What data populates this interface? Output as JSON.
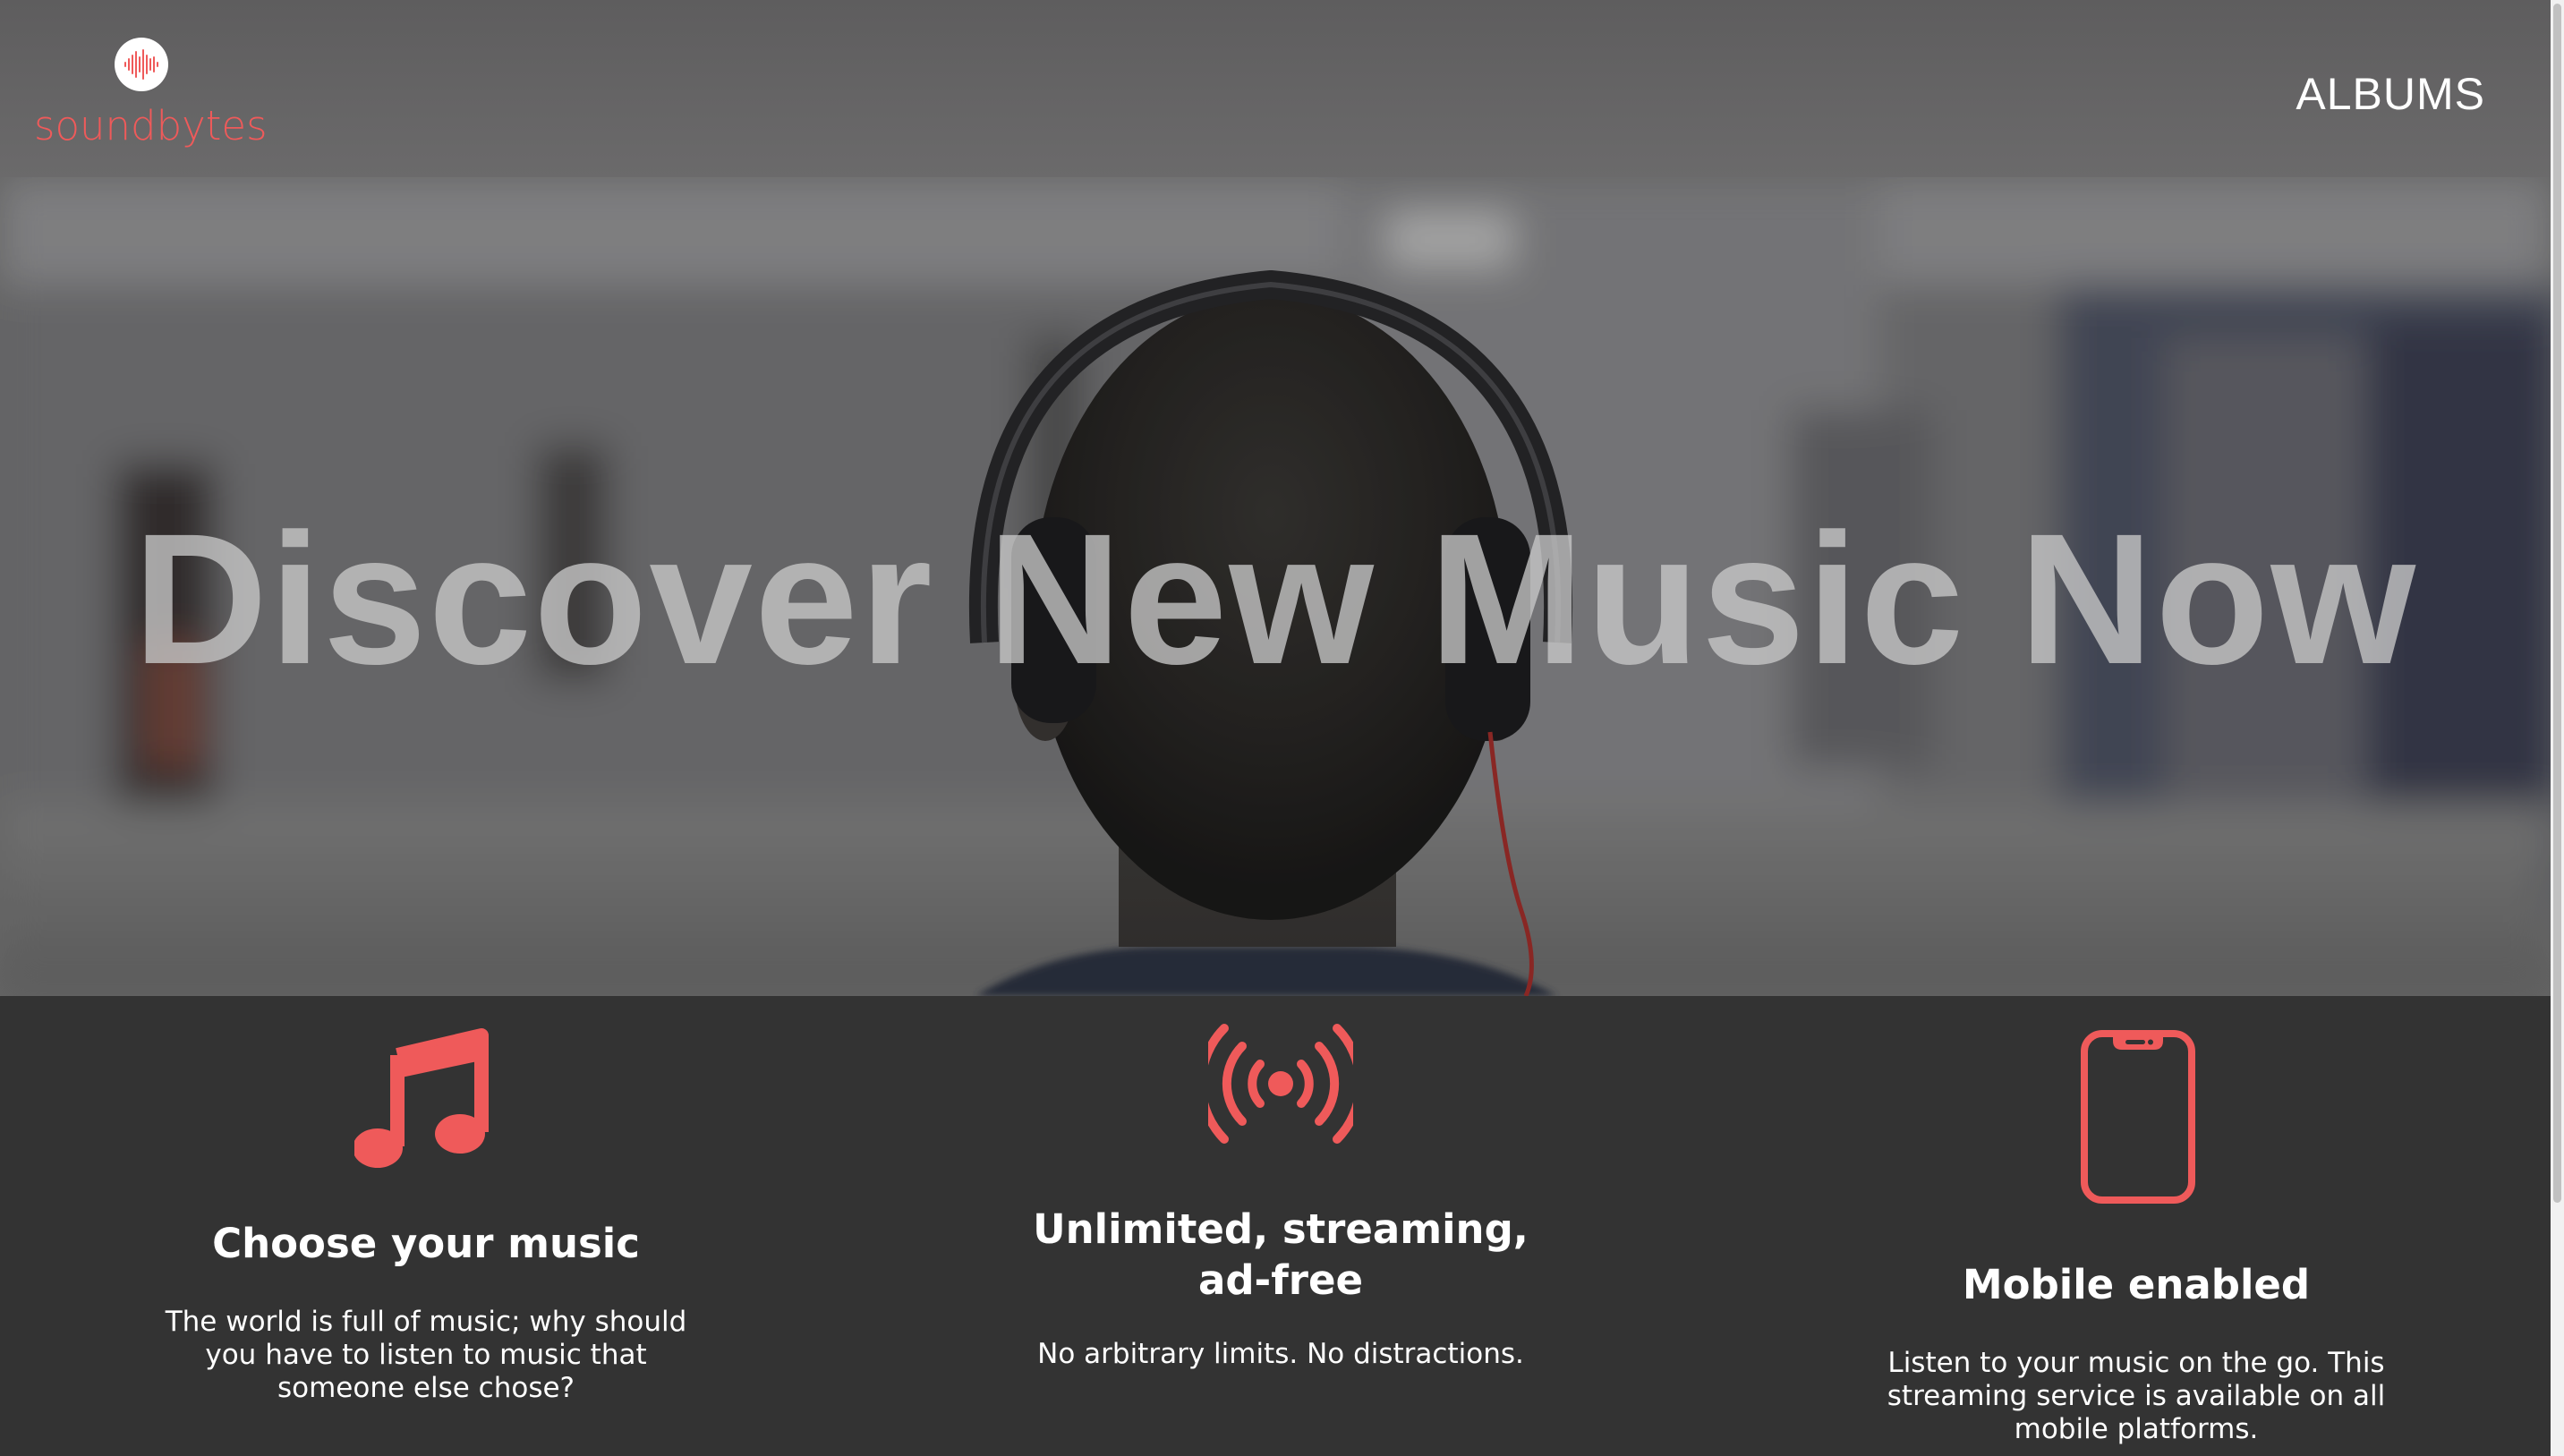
{
  "brand": {
    "name": "soundbytes",
    "color": "#ef5a5a"
  },
  "nav": {
    "albums_label": "ALBUMS"
  },
  "hero": {
    "headline": "Discover New Music Now"
  },
  "features": [
    {
      "icon": "music-note-icon",
      "title": "Choose your music",
      "description": "The world is full of music; why should you have to listen to music that someone else chose?"
    },
    {
      "icon": "broadcast-icon",
      "title": "Unlimited, streaming, ad-free",
      "description": "No arbitrary limits. No distractions."
    },
    {
      "icon": "smartphone-icon",
      "title": "Mobile enabled",
      "description": "Listen to your music on the go. This streaming service is available on all mobile platforms."
    }
  ],
  "colors": {
    "accent": "#ef5a5a",
    "header_bg": "#666566",
    "features_bg": "#333333"
  }
}
